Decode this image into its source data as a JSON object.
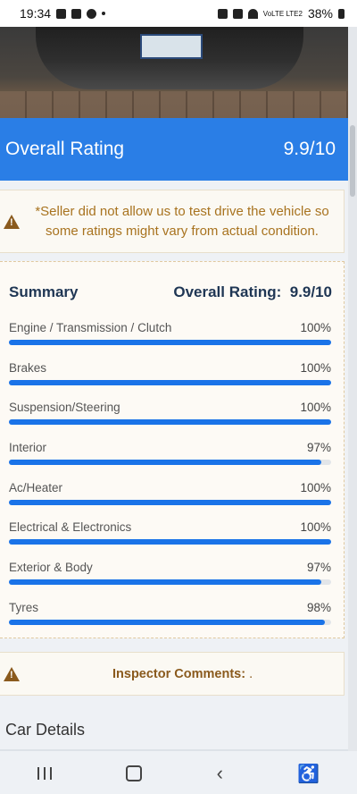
{
  "status_bar": {
    "time": "19:34",
    "signal_label": "VoLTE LTE2",
    "battery": "38%",
    "icons": [
      "gallery-icon",
      "stop-icon",
      "facebook-icon",
      "dot-icon",
      "lock-icon",
      "mute-icon",
      "wifi-icon",
      "battery-icon"
    ]
  },
  "rating_header": {
    "title": "Overall Rating",
    "score": "9.9/10"
  },
  "warning": {
    "text": "*Seller did not allow us to test drive the vehicle so some ratings might vary from actual condition."
  },
  "summary": {
    "title": "Summary",
    "overall_label": "Overall Rating:",
    "overall_value": "9.9/10",
    "items": [
      {
        "label": "Engine / Transmission / Clutch",
        "percent": "100%",
        "value": 100
      },
      {
        "label": "Brakes",
        "percent": "100%",
        "value": 100
      },
      {
        "label": "Suspension/Steering",
        "percent": "100%",
        "value": 100
      },
      {
        "label": "Interior",
        "percent": "97%",
        "value": 97
      },
      {
        "label": "Ac/Heater",
        "percent": "100%",
        "value": 100
      },
      {
        "label": "Electrical & Electronics",
        "percent": "100%",
        "value": 100
      },
      {
        "label": "Exterior & Body",
        "percent": "97%",
        "value": 97
      },
      {
        "label": "Tyres",
        "percent": "98%",
        "value": 98
      }
    ]
  },
  "inspector": {
    "label": "Inspector Comments:",
    "value": "."
  },
  "car_details": {
    "title": "Car Details"
  },
  "nav": {
    "icons": [
      "recents-icon",
      "home-icon",
      "back-icon",
      "accessibility-icon"
    ],
    "back_glyph": "‹",
    "accessibility_glyph": "♿"
  },
  "colors": {
    "accent": "#2a7ee6",
    "bar_fill": "#1a73e8",
    "warning": "#a8731f"
  }
}
